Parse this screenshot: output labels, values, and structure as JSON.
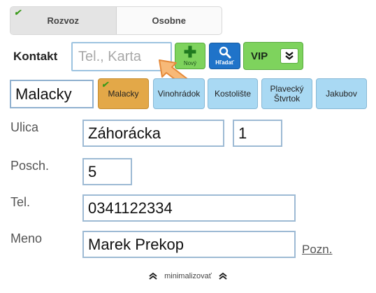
{
  "delivery_toggle": {
    "options": [
      "Rozvoz",
      "Osobne"
    ],
    "selected": "Rozvoz",
    "check_mark": "✔"
  },
  "contact": {
    "label": "Kontakt",
    "search_placeholder": "Tel., Karta",
    "new_label": "Nový",
    "find_label": "Hľadať",
    "vip_label": "VIP"
  },
  "city": {
    "value": "Malacky",
    "buttons": [
      "Malacky",
      "Vinohrádok",
      "Kostolište",
      "Plavecký Štvrtok",
      "Jakubov"
    ],
    "selected": "Malacky",
    "active_color": "#e3a848",
    "button_color": "#a9d9f3"
  },
  "form": {
    "street_label": "Ulica",
    "street_value": "Záhorácka",
    "number_value": "1",
    "floor_label": "Posch.",
    "floor_value": "5",
    "phone_label": "Tel.",
    "phone_value": "0341122334",
    "name_label": "Meno",
    "name_value": "Marek Prekop",
    "note_link": "Pozn."
  },
  "footer": {
    "minimize_label": "minimalizovať"
  },
  "colors": {
    "green_button": "#7ed35d",
    "blue_button": "#1f73c9",
    "field_border": "#9dbad4"
  }
}
